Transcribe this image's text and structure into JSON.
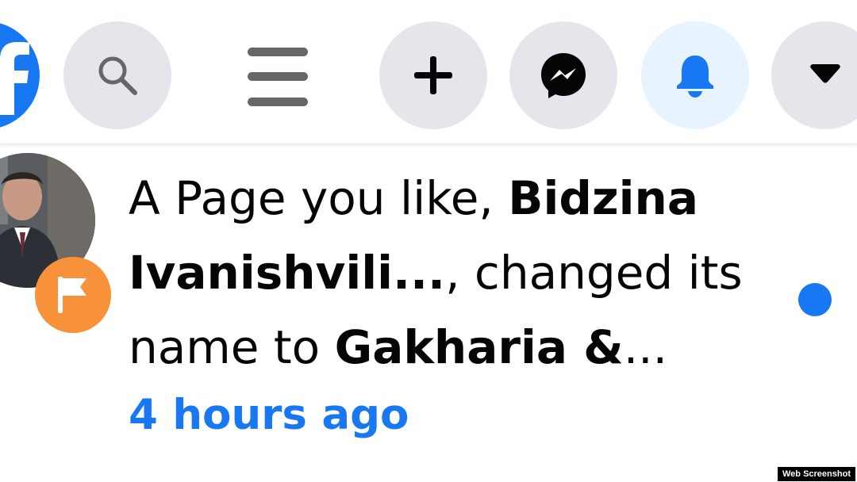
{
  "nav": {
    "logo_icon": "facebook-logo-icon",
    "buttons": [
      {
        "name": "search",
        "icon": "search-icon"
      },
      {
        "name": "menu",
        "icon": "menu-icon"
      },
      {
        "name": "create",
        "icon": "plus-icon"
      },
      {
        "name": "messenger",
        "icon": "messenger-icon"
      },
      {
        "name": "notifications",
        "icon": "bell-icon",
        "active": true
      },
      {
        "name": "account",
        "icon": "caret-down-icon"
      }
    ]
  },
  "notification": {
    "text_prefix": "A Page you like, ",
    "page_name": "Bidzina Ivanishvili...",
    "text_middle": ", changed its name to ",
    "new_name": "Gakharia &",
    "text_suffix": "...",
    "time": "4 hours ago",
    "badge_icon": "flag-icon",
    "unread": true
  },
  "watermark": "Web Screenshot",
  "colors": {
    "brand_blue": "#1877f2",
    "button_gray": "#e4e6eb",
    "active_bg": "#e7f3ff",
    "badge_orange": "#f7923b",
    "text": "#050505",
    "icon_gray": "#65676b"
  }
}
